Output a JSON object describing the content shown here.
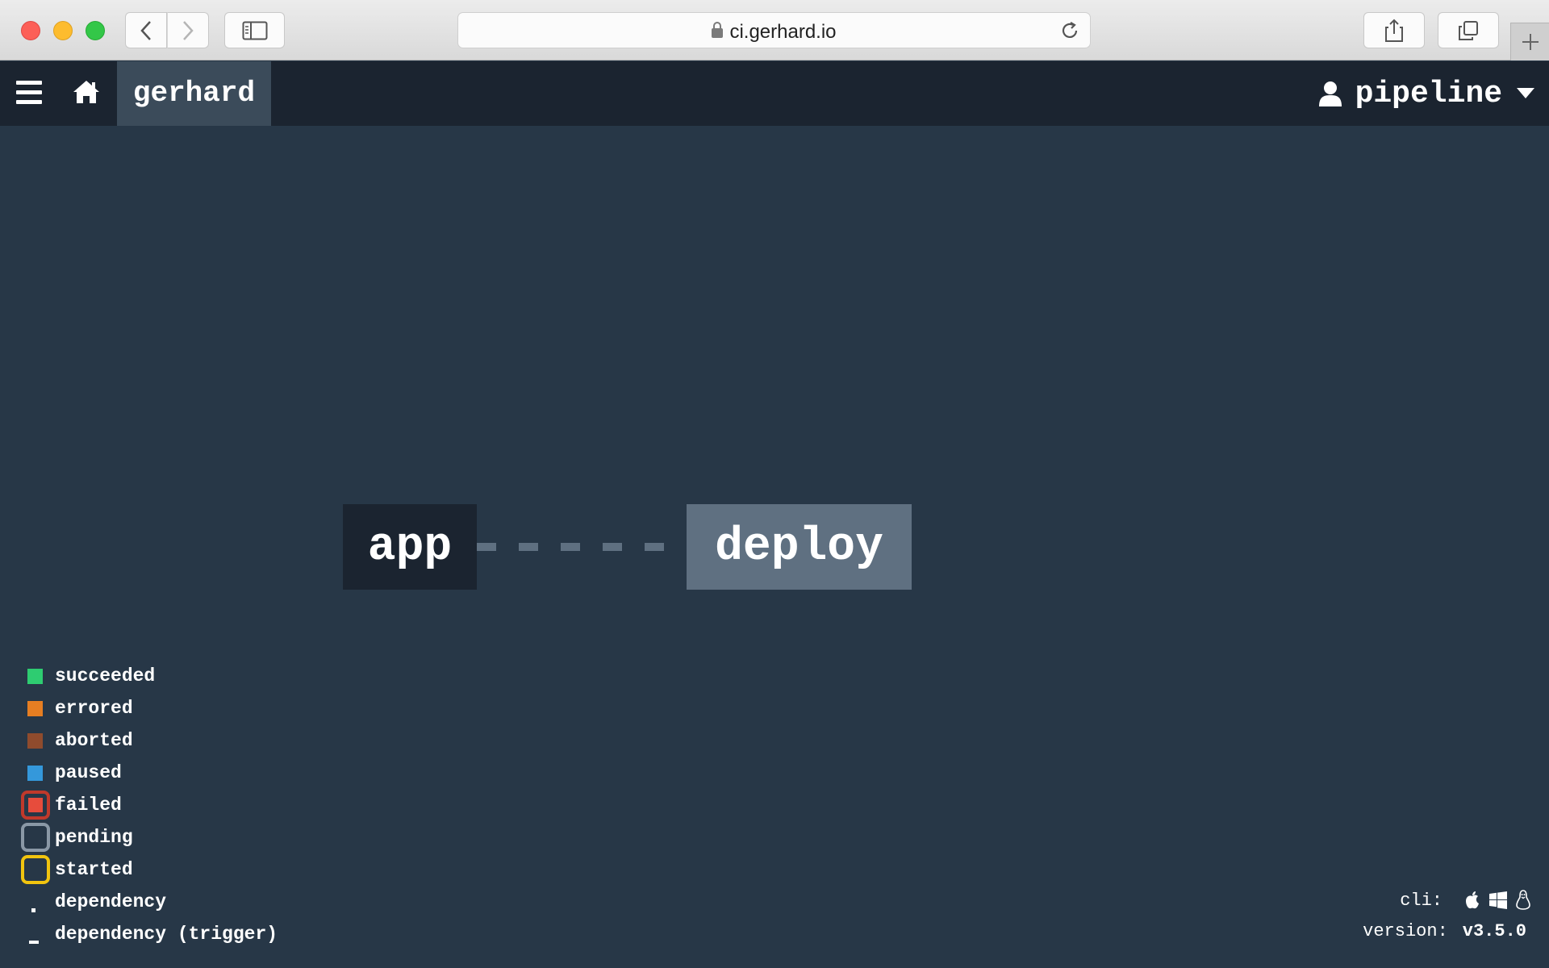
{
  "browser": {
    "url": "ci.gerhard.io"
  },
  "topbar": {
    "team": "gerhard",
    "user": "pipeline"
  },
  "pipeline": {
    "jobs": [
      {
        "name": "app",
        "status_color": "#1b2430"
      },
      {
        "name": "deploy",
        "status_color": "#5f7081"
      }
    ]
  },
  "legend": [
    {
      "label": "succeeded",
      "color": "#2ecc71"
    },
    {
      "label": "errored",
      "color": "#e67e22"
    },
    {
      "label": "aborted",
      "color": "#8f4b2d"
    },
    {
      "label": "paused",
      "color": "#3498db"
    },
    {
      "label": "failed",
      "color": "#e74c3c",
      "border": "#c0392b"
    },
    {
      "label": "pending",
      "border": "#8a98a6"
    },
    {
      "label": "started",
      "border": "#f1c40f"
    },
    {
      "label": "dependency"
    },
    {
      "label": "dependency (trigger)"
    }
  ],
  "footer": {
    "cli_label": "cli:",
    "cli_icons": [
      "apple-icon",
      "windows-icon",
      "linux-icon"
    ],
    "version_label": "version:",
    "version": "v3.5.0"
  }
}
